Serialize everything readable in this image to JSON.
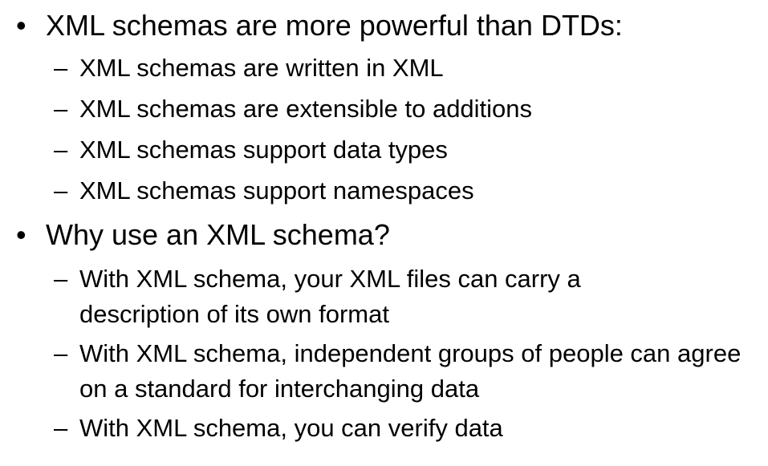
{
  "bullet_marker": "•",
  "sub_marker": "–",
  "sections": [
    {
      "heading": "XML schemas are more powerful than DTDs:",
      "items": [
        "XML schemas are written in XML",
        "XML schemas are extensible to additions",
        "XML schemas support data types",
        "XML schemas support namespaces"
      ]
    },
    {
      "heading": "Why use an XML schema?",
      "items": [
        "With XML schema, your XML files can carry a description of its own format",
        "With XML schema, independent groups of people can agree on a standard for interchanging data",
        "With XML schema, you can verify data"
      ]
    }
  ]
}
